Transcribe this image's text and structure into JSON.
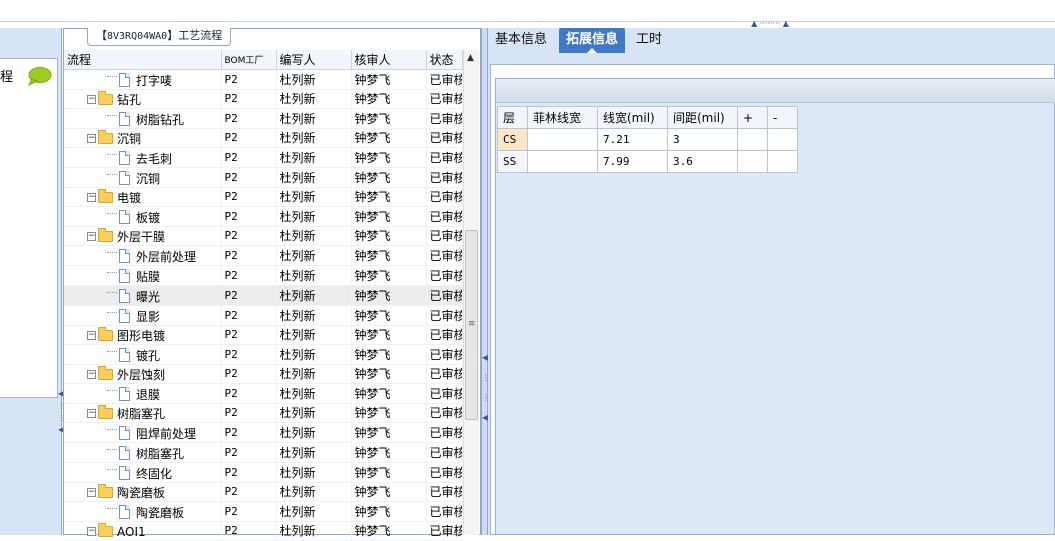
{
  "grid_title_prefix": "【",
  "grid_title_code": "8V3RQ04WA0",
  "grid_title_suffix": "】工艺流程",
  "left_panel": {
    "label": "程"
  },
  "tree": {
    "columns": [
      "流程",
      "BOM工厂",
      "编写人",
      "核审人",
      "状态"
    ],
    "rows": [
      {
        "type": "file",
        "name": "打字唛",
        "bom": "P2",
        "writer": "杜列新",
        "reviewer": "钟梦飞",
        "status": "已审核"
      },
      {
        "type": "folder",
        "name": "钻孔",
        "bom": "P2",
        "writer": "杜列新",
        "reviewer": "钟梦飞",
        "status": "已审核"
      },
      {
        "type": "file",
        "name": "树脂钻孔",
        "bom": "P2",
        "writer": "杜列新",
        "reviewer": "钟梦飞",
        "status": "已审核"
      },
      {
        "type": "folder",
        "name": "沉铜",
        "bom": "P2",
        "writer": "杜列新",
        "reviewer": "钟梦飞",
        "status": "已审核"
      },
      {
        "type": "file",
        "name": "去毛刺",
        "bom": "P2",
        "writer": "杜列新",
        "reviewer": "钟梦飞",
        "status": "已审核"
      },
      {
        "type": "file",
        "name": "沉铜",
        "bom": "P2",
        "writer": "杜列新",
        "reviewer": "钟梦飞",
        "status": "已审核"
      },
      {
        "type": "folder",
        "name": "电镀",
        "bom": "P2",
        "writer": "杜列新",
        "reviewer": "钟梦飞",
        "status": "已审核"
      },
      {
        "type": "file",
        "name": "板镀",
        "bom": "P2",
        "writer": "杜列新",
        "reviewer": "钟梦飞",
        "status": "已审核"
      },
      {
        "type": "folder",
        "name": "外层干膜",
        "bom": "P2",
        "writer": "杜列新",
        "reviewer": "钟梦飞",
        "status": "已审核"
      },
      {
        "type": "file",
        "name": "外层前处理",
        "bom": "P2",
        "writer": "杜列新",
        "reviewer": "钟梦飞",
        "status": "已审核"
      },
      {
        "type": "file",
        "name": "贴膜",
        "bom": "P2",
        "writer": "杜列新",
        "reviewer": "钟梦飞",
        "status": "已审核"
      },
      {
        "type": "file",
        "name": "曝光",
        "bom": "P2",
        "writer": "杜列新",
        "reviewer": "钟梦飞",
        "status": "已审核",
        "selected": true
      },
      {
        "type": "file",
        "name": "显影",
        "bom": "P2",
        "writer": "杜列新",
        "reviewer": "钟梦飞",
        "status": "已审核"
      },
      {
        "type": "folder",
        "name": "图形电镀",
        "bom": "P2",
        "writer": "杜列新",
        "reviewer": "钟梦飞",
        "status": "已审核"
      },
      {
        "type": "file",
        "name": "镀孔",
        "bom": "P2",
        "writer": "杜列新",
        "reviewer": "钟梦飞",
        "status": "已审核"
      },
      {
        "type": "folder",
        "name": "外层蚀刻",
        "bom": "P2",
        "writer": "杜列新",
        "reviewer": "钟梦飞",
        "status": "已审核"
      },
      {
        "type": "file",
        "name": "退膜",
        "bom": "P2",
        "writer": "杜列新",
        "reviewer": "钟梦飞",
        "status": "已审核"
      },
      {
        "type": "folder",
        "name": "树脂塞孔",
        "bom": "P2",
        "writer": "杜列新",
        "reviewer": "钟梦飞",
        "status": "已审核"
      },
      {
        "type": "file",
        "name": "阻焊前处理",
        "bom": "P2",
        "writer": "杜列新",
        "reviewer": "钟梦飞",
        "status": "已审核"
      },
      {
        "type": "file",
        "name": "树脂塞孔",
        "bom": "P2",
        "writer": "杜列新",
        "reviewer": "钟梦飞",
        "status": "已审核"
      },
      {
        "type": "file",
        "name": "终固化",
        "bom": "P2",
        "writer": "杜列新",
        "reviewer": "钟梦飞",
        "status": "已审核"
      },
      {
        "type": "folder",
        "name": "陶瓷磨板",
        "bom": "P2",
        "writer": "杜列新",
        "reviewer": "钟梦飞",
        "status": "已审核"
      },
      {
        "type": "file",
        "name": "陶瓷磨板",
        "bom": "P2",
        "writer": "杜列新",
        "reviewer": "钟梦飞",
        "status": "已审核"
      },
      {
        "type": "folder",
        "name": "AOI1",
        "bom": "P2",
        "writer": "杜列新",
        "reviewer": "钟梦飞",
        "status": "已审核"
      }
    ]
  },
  "tabs": [
    "基本信息",
    "拓展信息",
    "工时"
  ],
  "active_tab": 1,
  "info_table": {
    "columns": [
      "层",
      "菲林线宽",
      "线宽(mil)",
      "间距(mil)",
      "+",
      "-"
    ],
    "rows": [
      {
        "layer": "CS",
        "film": "",
        "width": "7.21",
        "spacing": "3"
      },
      {
        "layer": "SS",
        "film": "",
        "width": "7.99",
        "spacing": "3.6"
      }
    ]
  }
}
